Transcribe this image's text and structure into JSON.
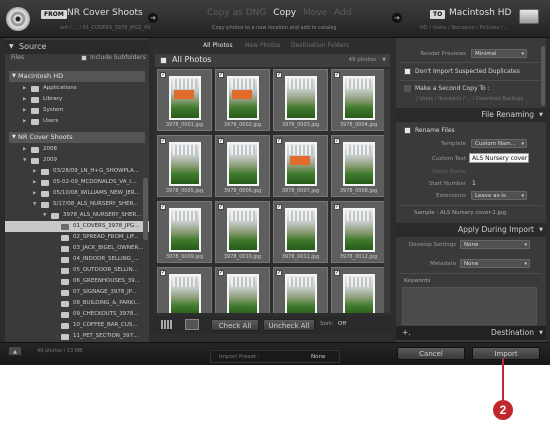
{
  "header": {
    "from_tag": "FROM",
    "source_name": "NR Cover Shoots",
    "source_path": "ant / ... / 01_COVERS_3978_JPGS_49",
    "modes": [
      "Copy as DNG",
      "Copy",
      "Move",
      "Add"
    ],
    "active_mode": "Copy",
    "mode_description": "Copy photos to a new location and add to catalog",
    "to_tag": "TO",
    "destination_name": "Macintosh HD",
    "destination_path": "HD / Users / lbocascio / Pictures / ..."
  },
  "source_panel": {
    "title": "Source",
    "files_label": "Files",
    "include_subfolders": "Include Subfolders",
    "volume1": "Macintosh HD",
    "volume1_items": [
      "Applications",
      "Library",
      "System",
      "Users"
    ],
    "volume2": "NR Cover Shoots",
    "volume2_items": [
      "2008",
      "2009",
      "03/28/09_LN_H+G_SHOWPLA...",
      "05-02-09_MCDONALDS_VA_I...",
      "05/10/08_WILLIAMS_NEW_JER...",
      "5/17/08_ALS_NURSERY_SHER...",
      "3978_ALS_NURSERY_SHER...",
      "01_COVERS_3978_JPG...",
      "02_SPREAD_FROM_LIF...",
      "03_JACK_BIGEL_OWNER...",
      "04_INDOOR_SELLING_...",
      "05_OUTDOOR_SELLIN...",
      "06_GREENHOUSES_39...",
      "07_SIGNAGE_3978_JP...",
      "08_BUILDING_&_PARKI...",
      "09_CHECKOUTS_3978...",
      "10_COFFEE_BAR_CUS...",
      "11_PET_SECTION_397..."
    ]
  },
  "center": {
    "tabs": [
      "All Photos",
      "New Photos",
      "Destination Folders"
    ],
    "header_title": "All Photos",
    "count": "49 photos",
    "photos": [
      "3978_0001.jpg",
      "3978_0002.jpg",
      "3978_0003.jpg",
      "3978_0004.jpg",
      "3978_0005.jpg",
      "3978_0006.jpg",
      "3978_0007.jpg",
      "3978_0008.jpg",
      "3978_0009.jpg",
      "3978_0010.jpg",
      "3978_0011.jpg",
      "3978_0012.jpg",
      "",
      "",
      "",
      ""
    ],
    "check_all": "Check All",
    "uncheck_all": "Uncheck All",
    "sort_label": "Sort:",
    "sort_value": "Off"
  },
  "right_panel": {
    "render_previews_label": "Render Previews",
    "render_previews_value": "Minimal",
    "dont_import_suspected": "Don't Import Suspected Duplicates",
    "make_second_copy": "Make a Second Copy To :",
    "second_copy_path": "/ Users / lbocascio / ... / Download Backups",
    "file_renaming_title": "File Renaming",
    "rename_files": "Rename Files",
    "template_label": "Template",
    "template_value": "Custom Nam...",
    "custom_text_label": "Custom Text",
    "custom_text_value": "ALS Nursery cover",
    "shoot_name_label": "Shoot Name",
    "start_number_label": "Start Number",
    "start_number_value": "1",
    "extensions_label": "Extensions",
    "extensions_value": "Leave as-is",
    "sample_text": "Sample : ALS Nursery cover-1.jpg",
    "apply_title": "Apply During Import",
    "develop_label": "Develop Settings",
    "develop_value": "None",
    "metadata_label": "Metadata",
    "metadata_value": "None",
    "keywords_label": "Keywords",
    "destination_title": "Destination",
    "plus": "+."
  },
  "footer": {
    "status": "49 photos / 13 MB",
    "preset_label": "Import Preset :",
    "preset_value": "None",
    "cancel": "Cancel",
    "import": "Import"
  },
  "callout": {
    "number": "2",
    "color": "#c0282d"
  }
}
